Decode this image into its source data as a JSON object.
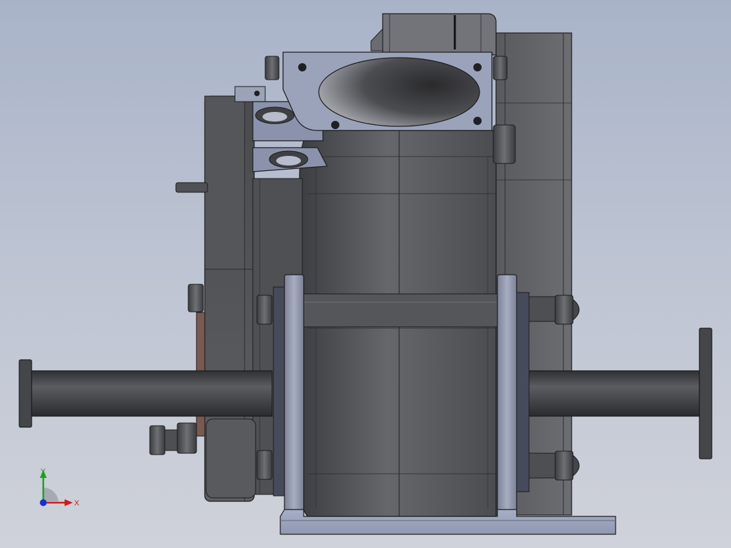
{
  "viewport": {
    "background_top": "#a9b3c8",
    "background_bottom": "#cfd2da"
  },
  "model": {
    "body_color": "#5d5e62",
    "edge_color": "#1c1c1e",
    "flange_plate_color": "#8a93ab",
    "bracket_color": "#5a6072"
  },
  "triad": {
    "x_label": "X",
    "y_label": "Y",
    "x_color": "#d21a1a",
    "y_color": "#1aa31a",
    "z_color": "#1a2fd2"
  }
}
